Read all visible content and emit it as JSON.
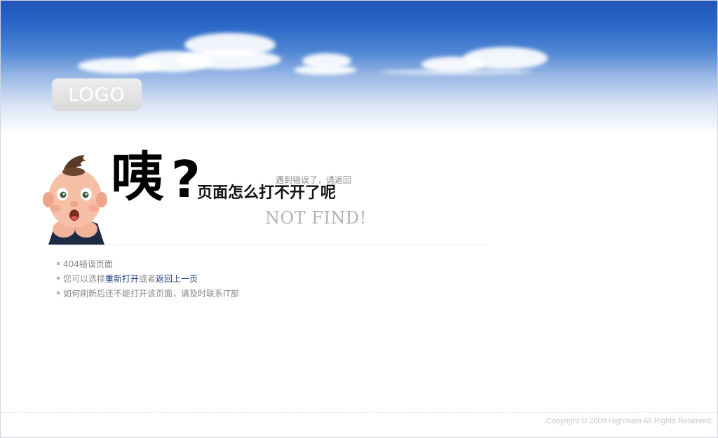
{
  "header": {
    "logo_text": "LOGO"
  },
  "headline": {
    "big_char": "咦",
    "question_mark": "?",
    "subtitle": "页面怎么打不开了呢",
    "hint": "遇到错误了，请返回",
    "not_find": "NOT FIND!"
  },
  "messages": {
    "line1": "404错误页面",
    "line2_prefix": "您可以选择",
    "line2_link1": "重新打开",
    "line2_middle": "或者",
    "line2_link2": "返回上一页",
    "line3": "如何刷新后还不能打开该页面，请及时联系IT部"
  },
  "footer": {
    "copyright": "Copyright © 2009 Highteam All Rights Reserved."
  },
  "colors": {
    "sky_top": "#1f56b8",
    "link": "#1a3b7a",
    "text_gray": "#888888"
  }
}
